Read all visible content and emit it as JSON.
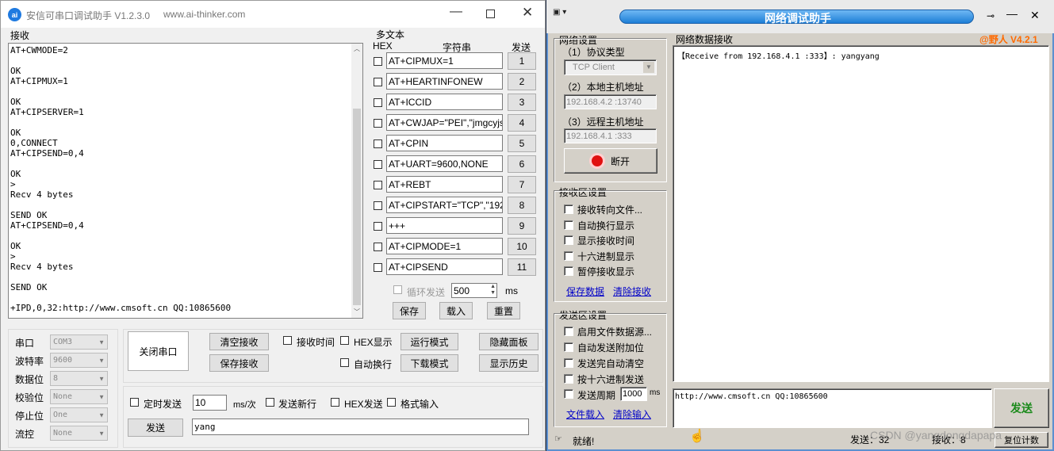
{
  "left": {
    "title": "安信可串口调试助手 V1.2.3.0",
    "url": "www.ai-thinker.com",
    "receive_label": "接收",
    "receive_lines": [
      "AT+CWMODE=2",
      "",
      "OK",
      "AT+CIPMUX=1",
      "",
      "OK",
      "AT+CIPSERVER=1",
      "",
      "OK",
      "0,CONNECT",
      "AT+CIPSEND=0,4",
      "",
      "OK",
      ">",
      "Recv 4 bytes",
      "",
      "SEND OK",
      "AT+CIPSEND=0,4",
      "",
      "OK",
      ">",
      "Recv 4 bytes",
      "",
      "SEND OK",
      "",
      "+IPD,0,32:http://www.cmsoft.cn QQ:10865600"
    ],
    "multi_text": {
      "title": "多文本",
      "hex_header": "HEX",
      "string_header": "字符串",
      "send_header": "发送",
      "rows": [
        {
          "text": "AT+CIPMUX=1",
          "num": "1"
        },
        {
          "text": "AT+HEARTINFONEW",
          "num": "2"
        },
        {
          "text": "AT+ICCID",
          "num": "3"
        },
        {
          "text": "AT+CWJAP=\"PEI\",\"jmgcyjs",
          "num": "4"
        },
        {
          "text": "AT+CPIN",
          "num": "5"
        },
        {
          "text": "AT+UART=9600,NONE",
          "num": "6"
        },
        {
          "text": "AT+REBT",
          "num": "7"
        },
        {
          "text": "AT+CIPSTART=\"TCP\",\"192",
          "num": "8"
        },
        {
          "text": "+++",
          "num": "9"
        },
        {
          "text": "AT+CIPMODE=1",
          "num": "10"
        },
        {
          "text": "AT+CIPSEND",
          "num": "11"
        }
      ],
      "loop_send": "循环发送",
      "interval": "500",
      "ms": "ms",
      "save": "保存",
      "load": "载入",
      "reset": "重置"
    },
    "port": {
      "port_label": "串口",
      "port_value": "COM3",
      "baud_label": "波特率",
      "baud_value": "9600",
      "data_label": "数据位",
      "data_value": "8",
      "parity_label": "校验位",
      "parity_value": "None",
      "stop_label": "停止位",
      "stop_value": "One",
      "flow_label": "流控",
      "flow_value": "None"
    },
    "controls": {
      "close_port": "关闭串口",
      "clear_recv": "清空接收",
      "save_recv": "保存接收",
      "recv_time": "接收时间",
      "hex_show": "HEX显示",
      "auto_wrap": "自动换行",
      "run_mode": "运行模式",
      "download_mode": "下载模式",
      "hide_panel": "隐藏面板",
      "show_history": "显示历史"
    },
    "send": {
      "timed_send": "定时发送",
      "period": "10",
      "unit": "ms/次",
      "newline": "发送新行",
      "hex_send": "HEX发送",
      "format_input": "格式输入",
      "send_button": "发送",
      "send_text": "yang"
    }
  },
  "right": {
    "title": "网络调试助手",
    "net_settings": "网络设置",
    "protocol_label": "（1）协议类型",
    "protocol_value": "TCP Client",
    "local_label": "（2）本地主机地址",
    "local_value": "192.168.4.2 :13740",
    "remote_label": "（3）远程主机地址",
    "remote_value": "192.168.4.1 :333",
    "disconnect": "断开",
    "recv_settings": "接收区设置",
    "recv_opts": [
      "接收转向文件...",
      "自动换行显示",
      "显示接收时间",
      "十六进制显示",
      "暂停接收显示"
    ],
    "save_data": "保存数据",
    "clear_recv": "清除接收",
    "send_settings": "发送区设置",
    "send_opts": [
      "启用文件数据源...",
      "自动发送附加位",
      "发送完自动清空",
      "按十六进制发送"
    ],
    "send_period": "发送周期",
    "period_value": "1000",
    "ms": "ms",
    "file_load": "文件载入",
    "clear_input": "清除输入",
    "recv_area_label": "网络数据接收",
    "brand": "@野人 V4.2.1",
    "recv_text": "【Receive from 192.168.4.1 :333】: yangyang",
    "send_text": "http://www.cmsoft.cn QQ:10865600",
    "send_button": "发送",
    "status_ready": "就绪!",
    "status_send": "发送：32",
    "status_recv": "接收：8",
    "status_reset": "复位计数",
    "watermark": "CSDN @yangdongdapapa"
  }
}
